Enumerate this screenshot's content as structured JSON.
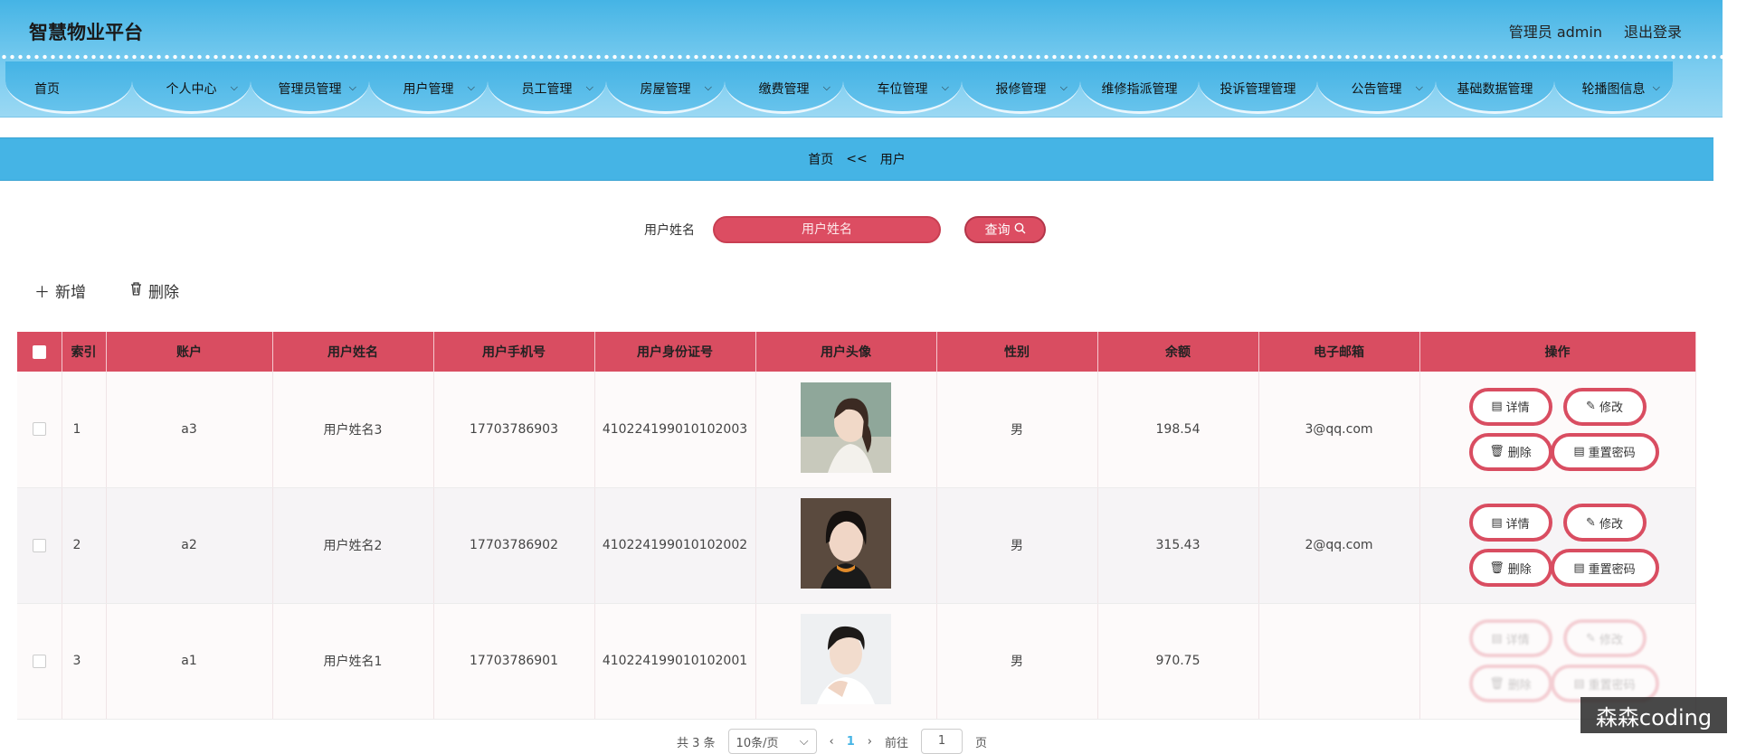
{
  "header": {
    "brand": "智慧物业平台",
    "user_label": "管理员 admin",
    "logout_label": "退出登录"
  },
  "nav": [
    {
      "label": "首页",
      "has_menu": false
    },
    {
      "label": "个人中心",
      "has_menu": true
    },
    {
      "label": "管理员管理",
      "has_menu": true
    },
    {
      "label": "用户管理",
      "has_menu": true
    },
    {
      "label": "员工管理",
      "has_menu": true
    },
    {
      "label": "房屋管理",
      "has_menu": true
    },
    {
      "label": "缴费管理",
      "has_menu": true
    },
    {
      "label": "车位管理",
      "has_menu": true
    },
    {
      "label": "报修管理",
      "has_menu": true
    },
    {
      "label": "维修指派管理",
      "has_menu": false
    },
    {
      "label": "投诉管理管理",
      "has_menu": false
    },
    {
      "label": "公告管理",
      "has_menu": true
    },
    {
      "label": "基础数据管理",
      "has_menu": false
    },
    {
      "label": "轮播图信息",
      "has_menu": true
    }
  ],
  "breadcrumb": {
    "home": "首页",
    "sep": "<<",
    "current": "用户"
  },
  "search": {
    "label": "用户姓名",
    "placeholder": "用户姓名",
    "button": "查询"
  },
  "actions": {
    "add": "新增",
    "delete": "删除"
  },
  "table": {
    "columns": [
      "索引",
      "账户",
      "用户姓名",
      "用户手机号",
      "用户身份证号",
      "用户头像",
      "性别",
      "余额",
      "电子邮箱",
      "操作"
    ],
    "op_labels": {
      "detail": "详情",
      "edit": "修改",
      "delete": "删除",
      "reset": "重置密码"
    },
    "rows": [
      {
        "index": "1",
        "account": "a3",
        "name": "用户姓名3",
        "phone": "17703786903",
        "idcard": "410224199010102003",
        "gender": "男",
        "balance": "198.54",
        "email": "3@qq.com",
        "avatar": "avatar-girl-1"
      },
      {
        "index": "2",
        "account": "a2",
        "name": "用户姓名2",
        "phone": "17703786902",
        "idcard": "410224199010102002",
        "gender": "男",
        "balance": "315.43",
        "email": "2@qq.com",
        "avatar": "avatar-girl-2"
      },
      {
        "index": "3",
        "account": "a1",
        "name": "用户姓名1",
        "phone": "17703786901",
        "idcard": "410224199010102001",
        "gender": "男",
        "balance": "970.75",
        "email": "",
        "avatar": "avatar-boy-1"
      }
    ]
  },
  "pager": {
    "total": "共 3 条",
    "page_size": "10条/页",
    "current_page": "1",
    "goto_label": "前往",
    "goto_value": "1",
    "page_suffix": "页"
  },
  "watermark": "森森coding",
  "colors": {
    "header_blue": "#45b4e5",
    "accent_red": "#d94d61"
  }
}
